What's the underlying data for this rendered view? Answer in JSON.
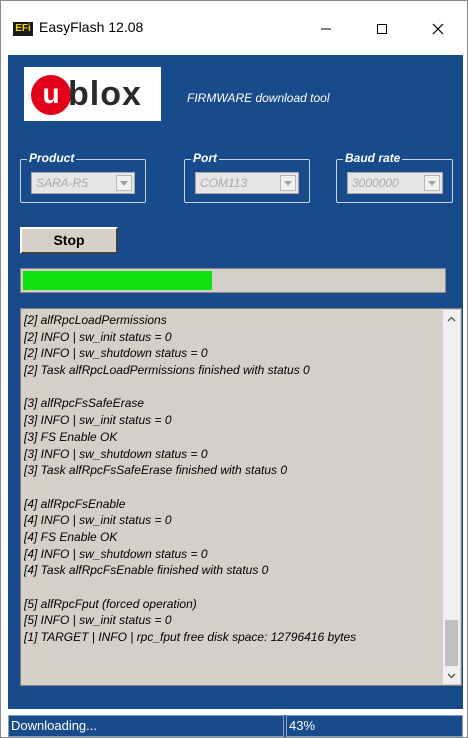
{
  "window": {
    "title": "EasyFlash 12.08",
    "app_icon_text": "EFi",
    "controls": {
      "minimize": "—",
      "maximize": "☐",
      "close": "✕"
    }
  },
  "logo": {
    "u_letter": "u",
    "brand": "blox"
  },
  "tagline": "FIRMWARE download tool",
  "groups": {
    "product": {
      "label": "Product",
      "value": "SARA-R5"
    },
    "port": {
      "label": "Port",
      "value": "COM113"
    },
    "baud": {
      "label": "Baud rate",
      "value": "3000000"
    }
  },
  "stop_button": "Stop",
  "progress": {
    "fraction": 0.45,
    "color": "#10e010"
  },
  "log": [
    "[2] alfRpcLoadPermissions",
    "[2] INFO  | sw_init status = 0",
    "[2] INFO  | sw_shutdown status = 0",
    "[2] Task alfRpcLoadPermissions finished with status 0",
    "",
    "[3] alfRpcFsSafeErase",
    "[3] INFO  | sw_init status = 0",
    "[3] FS Enable OK",
    "[3] INFO  | sw_shutdown status = 0",
    "[3] Task alfRpcFsSafeErase finished with status 0",
    "",
    "[4] alfRpcFsEnable",
    "[4] INFO  | sw_init status = 0",
    "[4] FS Enable OK",
    "[4] INFO  | sw_shutdown status = 0",
    "[4] Task alfRpcFsEnable finished with status 0",
    "",
    "[5] alfRpcFput (forced operation)",
    "[5] INFO  | sw_init status = 0",
    "[1] TARGET  | INFO    | rpc_fput free disk space: 12796416 bytes"
  ],
  "status": {
    "message": "Downloading...",
    "percent": "43%"
  },
  "colors": {
    "panel": "#184b8c",
    "logo_red": "#e3001b"
  }
}
